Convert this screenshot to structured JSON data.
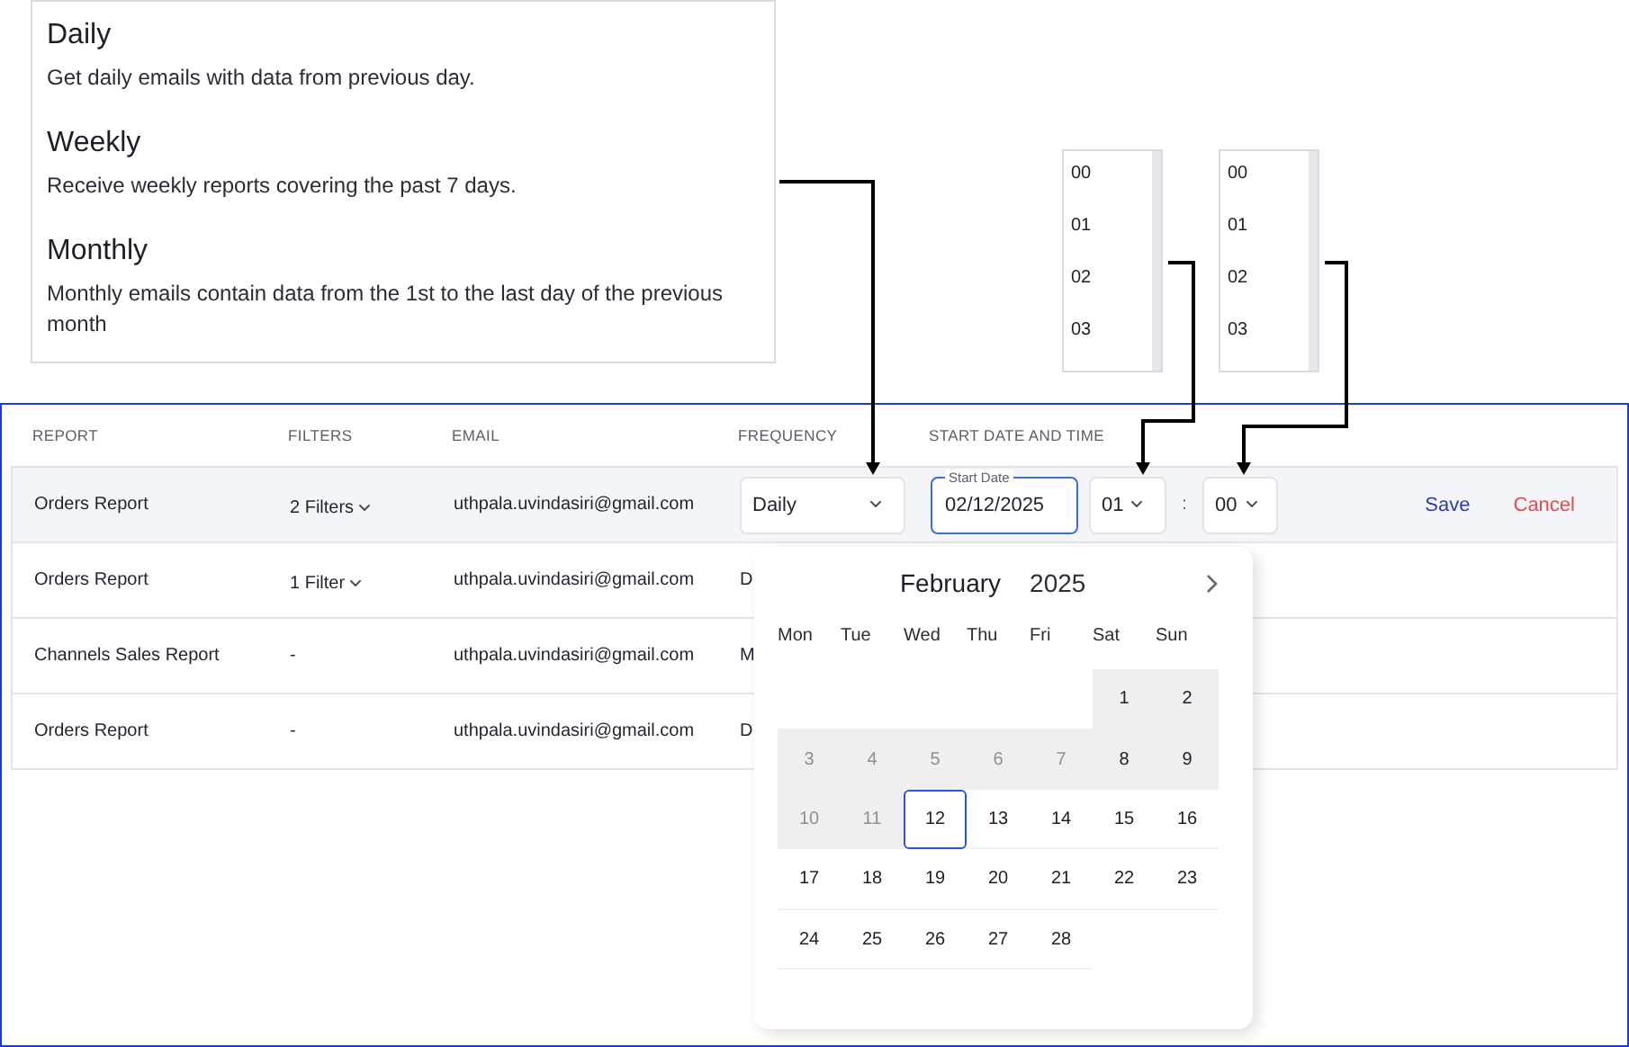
{
  "frequency_options": [
    {
      "title": "Daily",
      "description": "Get daily emails with data from previous day."
    },
    {
      "title": "Weekly",
      "description": "Receive weekly reports covering the past 7 days."
    },
    {
      "title": "Monthly",
      "description": "Monthly emails contain data from the 1st to the last day of the previous month"
    }
  ],
  "hour_list": [
    "00",
    "01",
    "02",
    "03"
  ],
  "minute_list": [
    "00",
    "01",
    "02",
    "03"
  ],
  "table": {
    "columns": [
      "REPORT",
      "FILTERS",
      "EMAIL",
      "FREQUENCY",
      "START DATE AND TIME"
    ],
    "rows": [
      {
        "report": "Orders Report",
        "filters": "2 Filters",
        "filters_dropdown": true,
        "email": "uthpala.uvindasiri@gmail.com",
        "frequency": "Daily",
        "selected": true
      },
      {
        "report": "Orders Report",
        "filters": "1 Filter",
        "filters_dropdown": true,
        "email": "uthpala.uvindasiri@gmail.com",
        "frequency": "D",
        "selected": false
      },
      {
        "report": "Channels Sales Report",
        "filters": "-",
        "filters_dropdown": false,
        "email": "uthpala.uvindasiri@gmail.com",
        "frequency": "M",
        "selected": false
      },
      {
        "report": "Orders Report",
        "filters": "-",
        "filters_dropdown": false,
        "email": "uthpala.uvindasiri@gmail.com",
        "frequency": "D",
        "selected": false
      }
    ],
    "editor": {
      "start_date_label": "Start Date",
      "start_date": "02/12/2025",
      "hour": "01",
      "separator": ":",
      "minute": "00",
      "save": "Save",
      "cancel": "Cancel"
    }
  },
  "calendar": {
    "month": "February",
    "year": "2025",
    "weekdays": [
      "Mon",
      "Tue",
      "Wed",
      "Thu",
      "Fri",
      "Sat",
      "Sun"
    ],
    "days": [
      {
        "kind": "blank"
      },
      {
        "kind": "blank"
      },
      {
        "kind": "blank"
      },
      {
        "kind": "blank"
      },
      {
        "kind": "blank"
      },
      {
        "kind": "day",
        "label": "1",
        "shaded": true,
        "disabled": false,
        "selected": false
      },
      {
        "kind": "day",
        "label": "2",
        "shaded": true,
        "disabled": false,
        "selected": false
      },
      {
        "kind": "day",
        "label": "3",
        "shaded": true,
        "disabled": true,
        "selected": false
      },
      {
        "kind": "day",
        "label": "4",
        "shaded": true,
        "disabled": true,
        "selected": false
      },
      {
        "kind": "day",
        "label": "5",
        "shaded": true,
        "disabled": true,
        "selected": false
      },
      {
        "kind": "day",
        "label": "6",
        "shaded": true,
        "disabled": true,
        "selected": false
      },
      {
        "kind": "day",
        "label": "7",
        "shaded": true,
        "disabled": true,
        "selected": false
      },
      {
        "kind": "day",
        "label": "8",
        "shaded": true,
        "disabled": false,
        "selected": false
      },
      {
        "kind": "day",
        "label": "9",
        "shaded": true,
        "disabled": false,
        "selected": false
      },
      {
        "kind": "day",
        "label": "10",
        "shaded": true,
        "disabled": true,
        "selected": false
      },
      {
        "kind": "day",
        "label": "11",
        "shaded": true,
        "disabled": true,
        "selected": false
      },
      {
        "kind": "day",
        "label": "12",
        "shaded": false,
        "disabled": false,
        "selected": true
      },
      {
        "kind": "day",
        "label": "13",
        "shaded": false,
        "disabled": false,
        "selected": false
      },
      {
        "kind": "day",
        "label": "14",
        "shaded": false,
        "disabled": false,
        "selected": false
      },
      {
        "kind": "day",
        "label": "15",
        "shaded": false,
        "disabled": false,
        "selected": false
      },
      {
        "kind": "day",
        "label": "16",
        "shaded": false,
        "disabled": false,
        "selected": false
      },
      {
        "kind": "day",
        "label": "17",
        "shaded": false,
        "disabled": false,
        "selected": false
      },
      {
        "kind": "day",
        "label": "18",
        "shaded": false,
        "disabled": false,
        "selected": false
      },
      {
        "kind": "day",
        "label": "19",
        "shaded": false,
        "disabled": false,
        "selected": false
      },
      {
        "kind": "day",
        "label": "20",
        "shaded": false,
        "disabled": false,
        "selected": false
      },
      {
        "kind": "day",
        "label": "21",
        "shaded": false,
        "disabled": false,
        "selected": false
      },
      {
        "kind": "day",
        "label": "22",
        "shaded": false,
        "disabled": false,
        "selected": false
      },
      {
        "kind": "day",
        "label": "23",
        "shaded": false,
        "disabled": false,
        "selected": false
      },
      {
        "kind": "day",
        "label": "24",
        "shaded": false,
        "disabled": false,
        "selected": false
      },
      {
        "kind": "day",
        "label": "25",
        "shaded": false,
        "disabled": false,
        "selected": false
      },
      {
        "kind": "day",
        "label": "26",
        "shaded": false,
        "disabled": false,
        "selected": false
      },
      {
        "kind": "day",
        "label": "27",
        "shaded": false,
        "disabled": false,
        "selected": false
      },
      {
        "kind": "day",
        "label": "28",
        "shaded": false,
        "disabled": false,
        "selected": false
      }
    ]
  }
}
